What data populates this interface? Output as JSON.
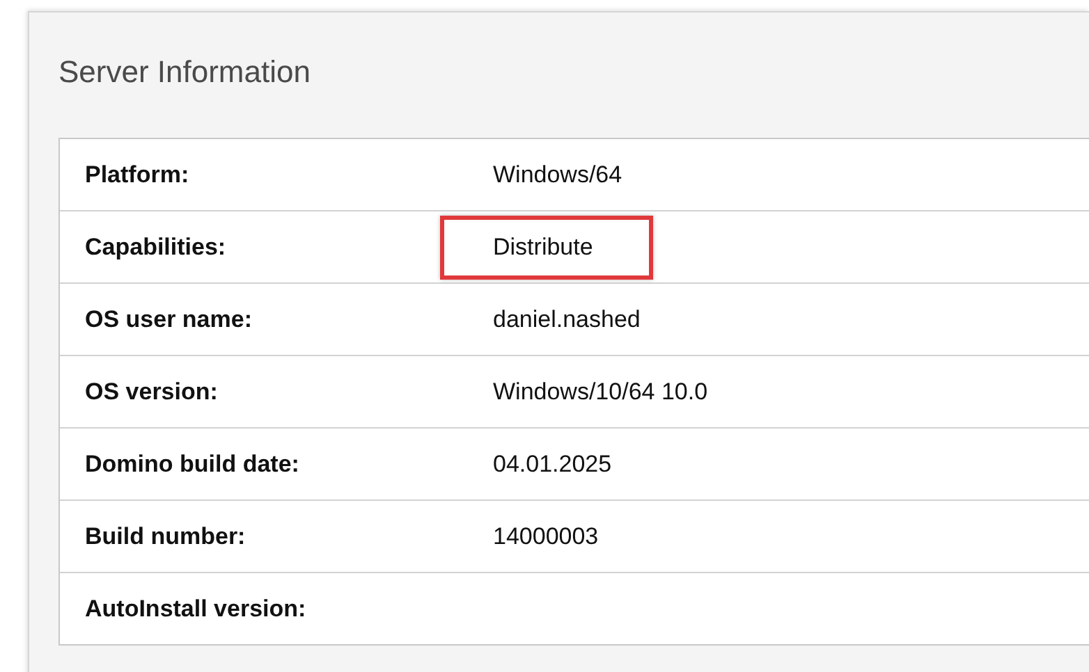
{
  "panel": {
    "title": "Server Information"
  },
  "rows": [
    {
      "label": "Platform:",
      "value": "Windows/64",
      "highlighted": false
    },
    {
      "label": "Capabilities:",
      "value": "Distribute",
      "highlighted": true
    },
    {
      "label": "OS user name:",
      "value": "daniel.nashed",
      "highlighted": false
    },
    {
      "label": "OS version:",
      "value": "Windows/10/64 10.0",
      "highlighted": false
    },
    {
      "label": "Domino build date:",
      "value": "04.01.2025",
      "highlighted": false
    },
    {
      "label": "Build number:",
      "value": "14000003",
      "highlighted": false
    },
    {
      "label": "AutoInstall version:",
      "value": "",
      "highlighted": false
    }
  ]
}
